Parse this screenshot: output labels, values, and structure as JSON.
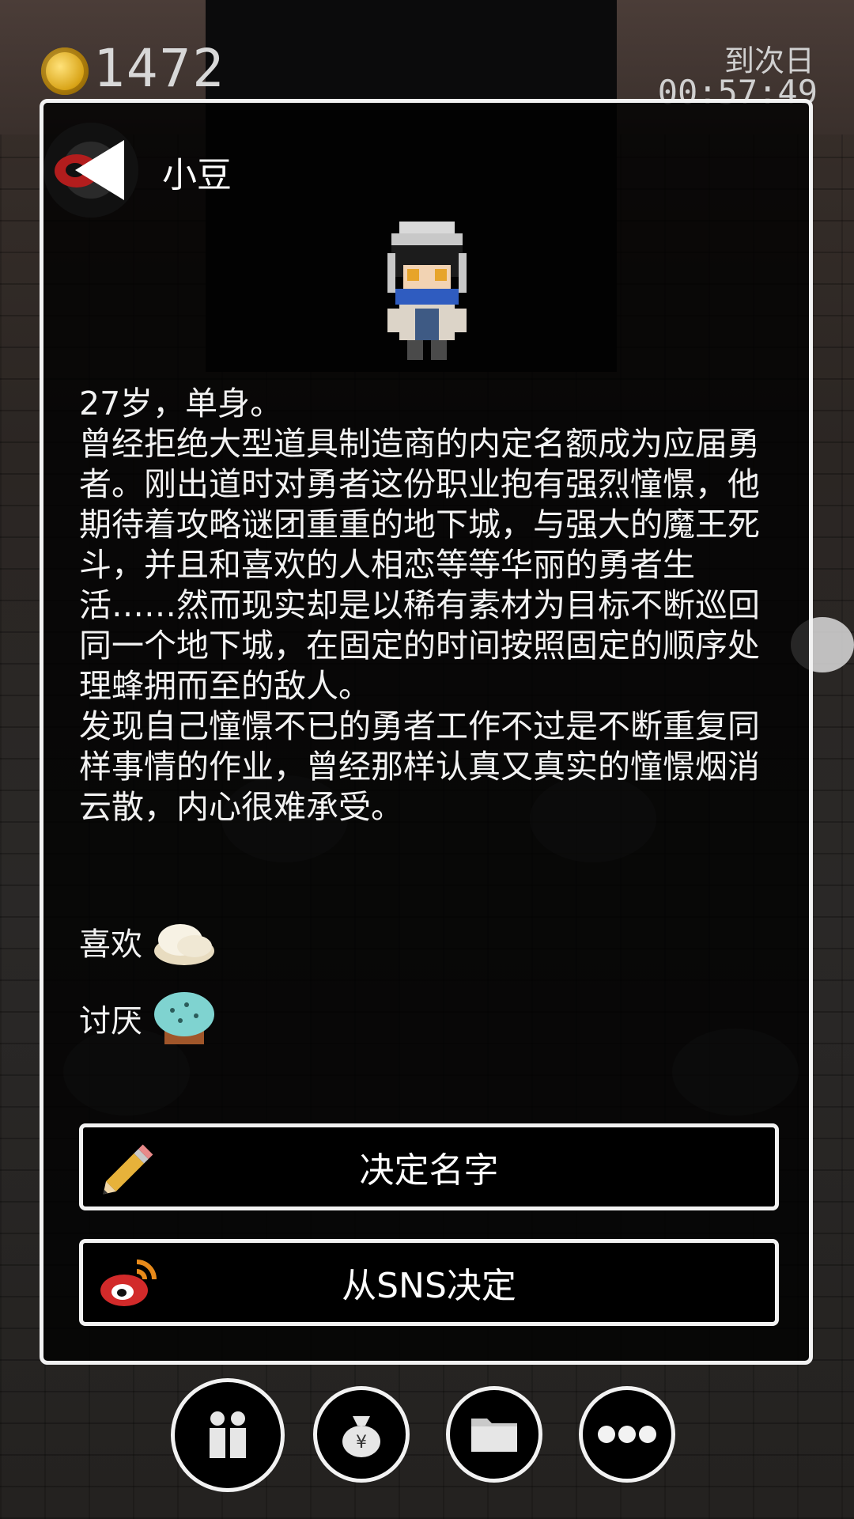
{
  "hud": {
    "coins": "1472",
    "timer_label": "到次日",
    "timer_value": "00:57:49"
  },
  "panel": {
    "character_name": "小豆",
    "description": "27岁，单身。\n曾经拒绝大型道具制造商的内定名额成为应届勇者。刚出道时对勇者这份职业抱有强烈憧憬，他期待着攻略谜团重重的地下城，与强大的魔王死斗，并且和喜欢的人相恋等等华丽的勇者生活……然而现实却是以稀有素材为目标不断巡回同一个地下城，在固定的时间按照固定的顺序处理蜂拥而至的敌人。\n发现自己憧憬不已的勇者工作不过是不断重复同样事情的作业，曾经那样认真又真实的憧憬烟消云散，内心很难承受。",
    "likes_label": "喜欢",
    "dislikes_label": "讨厌",
    "decide_name_label": "决定名字",
    "sns_decide_label": "从SNS决定"
  },
  "toolbar": {
    "icons": [
      "people-icon",
      "money-bag-icon",
      "folder-icon",
      "more-icon"
    ]
  },
  "colors": {
    "panel_border": "#f2f2f2",
    "panel_bg": "#000000",
    "coin": "#d8a316",
    "weibo_red": "#d22a2a"
  }
}
